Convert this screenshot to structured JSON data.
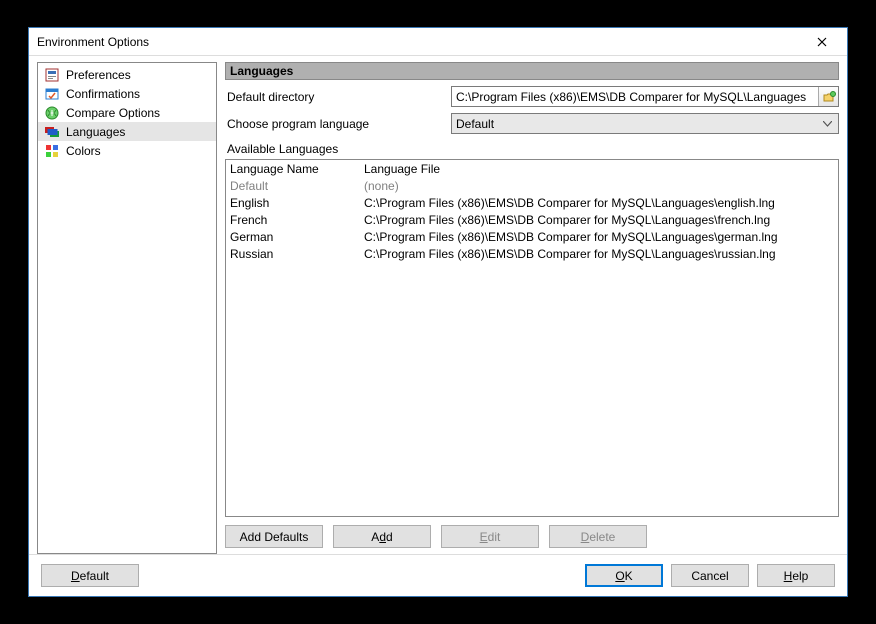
{
  "window": {
    "title": "Environment Options"
  },
  "sidebar": {
    "items": [
      {
        "label": "Preferences"
      },
      {
        "label": "Confirmations"
      },
      {
        "label": "Compare Options"
      },
      {
        "label": "Languages"
      },
      {
        "label": "Colors"
      }
    ]
  },
  "panel": {
    "header": "Languages",
    "default_dir_label": "Default directory",
    "default_dir_value": "C:\\Program Files (x86)\\EMS\\DB Comparer for MySQL\\Languages",
    "choose_lang_label": "Choose program language",
    "choose_lang_value": "Default",
    "available_label": "Available Languages",
    "columns": {
      "name": "Language Name",
      "file": "Language File"
    },
    "rows": [
      {
        "name": "Default",
        "file": "(none)",
        "muted": true
      },
      {
        "name": "English",
        "file": "C:\\Program Files (x86)\\EMS\\DB Comparer for MySQL\\Languages\\english.lng"
      },
      {
        "name": "French",
        "file": "C:\\Program Files (x86)\\EMS\\DB Comparer for MySQL\\Languages\\french.lng"
      },
      {
        "name": "German",
        "file": "C:\\Program Files (x86)\\EMS\\DB Comparer for MySQL\\Languages\\german.lng"
      },
      {
        "name": "Russian",
        "file": "C:\\Program Files (x86)\\EMS\\DB Comparer for MySQL\\Languages\\russian.lng"
      }
    ],
    "buttons": {
      "add_defaults": "Add Defaults",
      "add_pre": "A",
      "add_ul": "d",
      "add_post": "d",
      "edit_pre": "",
      "edit_ul": "E",
      "edit_post": "dit",
      "delete_pre": "",
      "delete_ul": "D",
      "delete_post": "elete"
    }
  },
  "footer": {
    "default_pre": "",
    "default_ul": "D",
    "default_post": "efault",
    "ok_pre": "",
    "ok_ul": "O",
    "ok_post": "K",
    "cancel": "Cancel",
    "help_pre": "",
    "help_ul": "H",
    "help_post": "elp"
  }
}
